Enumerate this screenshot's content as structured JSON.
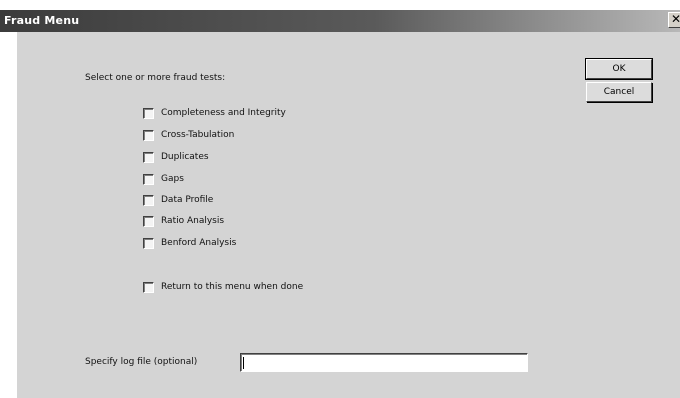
{
  "window": {
    "title": "Fraud Menu",
    "close_symbol": "✕"
  },
  "dialog": {
    "prompt": "Select one or more fraud tests:",
    "tests": [
      {
        "label": "Completeness and Integrity",
        "checked": false
      },
      {
        "label": "Cross-Tabulation",
        "checked": false
      },
      {
        "label": "Duplicates",
        "checked": false
      },
      {
        "label": "Gaps",
        "checked": false
      },
      {
        "label": "Data Profile",
        "checked": false
      },
      {
        "label": "Ratio Analysis",
        "checked": false
      },
      {
        "label": "Benford Analysis",
        "checked": false
      }
    ],
    "return_option": {
      "label": "Return to this menu when done",
      "checked": false
    },
    "buttons": {
      "ok_label": "OK",
      "cancel_label": "Cancel"
    },
    "log_file": {
      "label": "Specify log file (optional)",
      "value": ""
    }
  },
  "colors": {
    "title_bar_dark": "#3c3c3c",
    "client_background": "#d4d4d4"
  }
}
